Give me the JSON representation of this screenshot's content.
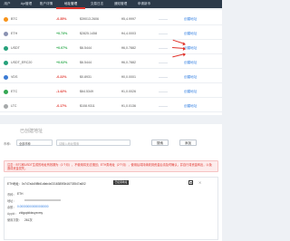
{
  "nav": {
    "tabs": [
      {
        "label": "用户"
      },
      {
        "label": "Api管理"
      },
      {
        "label": "账户详情"
      },
      {
        "label": "地址管理"
      },
      {
        "label": "交易日志"
      },
      {
        "label": "通知管理"
      },
      {
        "label": "申请新币"
      }
    ],
    "active_index": 3
  },
  "coins": [
    {
      "name": "BTC",
      "change": "-0.35%",
      "usd": "$39013.2606",
      "sub": "¥5,4.9997",
      "action": "创建地址",
      "direction": "down",
      "icon_color": "#f7931a",
      "bar_color": "#f7931a",
      "bar_level": 0.6
    },
    {
      "name": "ETH",
      "change": "+0.73%",
      "usd": "$2825.1458",
      "sub": "¥4,4.0003",
      "action": "创建地址",
      "direction": "up",
      "icon_color": "#8a92b2",
      "bar_color": "#6b7bd6",
      "bar_level": 0.5
    },
    {
      "name": "USDT",
      "change": "+0.07%",
      "usd": "$6.5444",
      "sub": "¥6,0.7882",
      "action": "创建地址",
      "direction": "up",
      "icon_color": "#26a17b",
      "bar_color": "#26a17b",
      "bar_level": 0.55
    },
    {
      "name": "USDT_ERC20",
      "change": "+0.02%",
      "usd": "$6.5444",
      "sub": "¥6,0.7882",
      "action": "创建地址",
      "direction": "up",
      "icon_color": "#26a17b",
      "bar_color": "#26a17b",
      "bar_level": 0.55
    },
    {
      "name": "VDS",
      "change": "-0.22%",
      "usd": "$0.8931",
      "sub": "¥0,0.0001",
      "action": "创建地址",
      "direction": "down",
      "icon_color": "#3b7bd4",
      "bar_color": "#3b7bd4",
      "bar_level": 0.3
    },
    {
      "name": "ETC",
      "change": "-1.42%",
      "usd": "$64.5349",
      "sub": "¥1,0.0026",
      "action": "创建地址",
      "direction": "down",
      "icon_color": "#34a853",
      "bar_color": "#34a853",
      "bar_level": 0.45
    },
    {
      "name": "LTC",
      "change": "-0.17%",
      "usd": "$108.9311",
      "sub": "¥1,0.0136",
      "action": "创建地址",
      "direction": "down",
      "icon_color": "#a6a9aa",
      "bar_color": "#7a8ca3",
      "bar_level": 0.4
    }
  ],
  "addresses": {
    "title": "已创建地址",
    "filter": {
      "label": "币种：",
      "select_value": "全部币种",
      "input_placeholder": "请输入地址搜索",
      "search_label": "搜索",
      "add_label": "添加"
    },
    "notice": "注意：BTC和USDT生成的地址有效期为（1个月），不使用将无法找回；ETH类地址（2个月），使用后将持续收到资金后请及时确认，并自行将资金转出，以免造成资金损失。",
    "item": {
      "head": "ETH地址：0x747a4d0f8fd1dfab4e2316385f3b16703547a602",
      "badge": "已使用地址",
      "coin_label": "币种：",
      "coin_value": "ETH",
      "key_label": "地址：",
      "balance_label": "余额：",
      "balance_value": "0.000000000000000000",
      "appid_label": "AppId：",
      "appid_value": "zIdgupkktzuyxvmy",
      "count_label": "使用次数：",
      "count_value": "261次"
    }
  }
}
